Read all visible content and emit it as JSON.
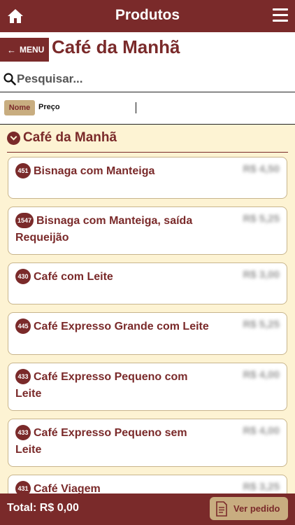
{
  "header": {
    "title": "Produtos",
    "home_icon": "home-icon",
    "menu_icon": "hamburger-icon"
  },
  "titlebar": {
    "back_label": "MENU",
    "page_title": "Café da Manhã"
  },
  "search": {
    "placeholder": "Pesquisar..."
  },
  "sort": {
    "nome_label": "Nome",
    "preco_label": "Preço"
  },
  "section": {
    "title": "Café da Manhã"
  },
  "products": [
    {
      "code": "451",
      "name": "Bisnaga com Manteiga",
      "price": "R$ 4,50"
    },
    {
      "code": "1547",
      "name": "Bisnaga com Manteiga, saída Requeijão",
      "price": "R$ 5,25"
    },
    {
      "code": "430",
      "name": "Café com Leite",
      "price": "R$ 3,00"
    },
    {
      "code": "445",
      "name": "Café Expresso Grande com Leite",
      "price": "R$ 5,25"
    },
    {
      "code": "433",
      "name": "Café Expresso Pequeno com Leite",
      "price": "R$ 4,00"
    },
    {
      "code": "433",
      "name": "Café Expresso Pequeno sem Leite",
      "price": "R$ 4,00"
    },
    {
      "code": "431",
      "name": "Café Viagem",
      "price": "R$ 3,25"
    }
  ],
  "footer": {
    "total_label": "Total: R$ 0,00",
    "order_button": "Ver pedido"
  },
  "colors": {
    "brand": "#7a2a2a",
    "background": "#fdf3d3",
    "accent": "#c8ad80"
  }
}
